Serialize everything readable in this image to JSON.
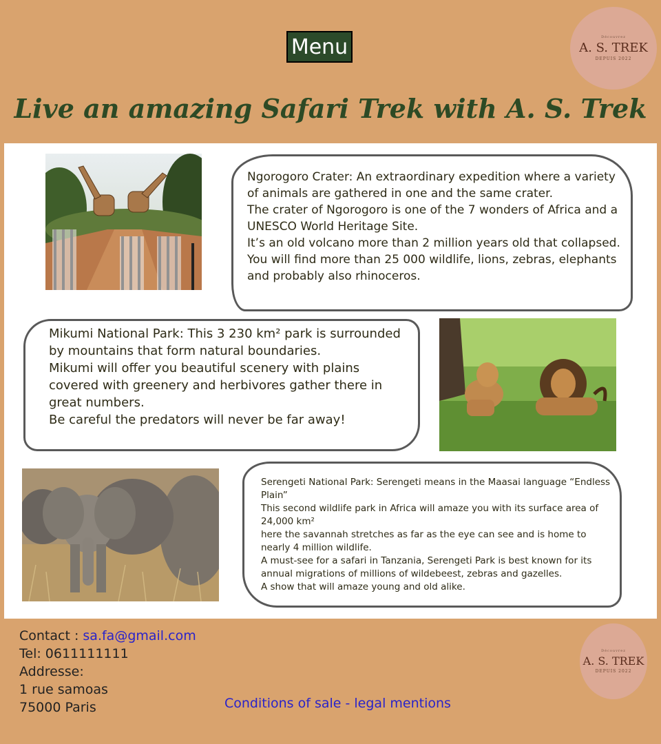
{
  "header": {
    "menu_label": "Menu",
    "logo": {
      "small": "Découvrez",
      "name": "A. S. TREK",
      "sub": "DEPUIS 2022"
    }
  },
  "headline": "Live an amazing Safari Trek with A. S. Trek",
  "sections": [
    {
      "image": "giraffes-zebras-photo",
      "lines": [
        "Ngorogoro Crater: An extraordinary expedition where a variety of animals are gathered in one and the same crater.",
        "The crater of Ngorogoro is one of the 7 wonders of Africa and a UNESCO World Heritage Site.",
        "It’s an old volcano more than 2 million years old that collapsed.",
        "You will find more than 25 000 wildlife, lions, zebras, elephants and probably also rhinoceros."
      ]
    },
    {
      "image": "lions-photo",
      "lines": [
        "Mikumi National Park: This 3 230 km² park is surrounded by mountains that form natural boundaries.",
        "Mikumi will offer you beautiful scenery with plains covered with greenery and herbivores gather there in great numbers.",
        "Be careful the predators will never be far away!"
      ]
    },
    {
      "image": "elephants-photo",
      "lines": [
        "Serengeti National Park: Serengeti means in the Maasai language “Endless Plain”",
        "This second wildlife park in Africa will amaze you with its surface area of 24,000 km²",
        "here the savannah stretches as far as the eye can see and is home to nearly 4 million wildlife.",
        "A must-see for a safari in Tanzania, Serengeti Park is best known for its annual migrations of millions of wildebeest, zebras and gazelles.",
        "A show that will amaze young and old alike."
      ]
    }
  ],
  "footer": {
    "contact_label": "Contact : ",
    "email": "sa.fa@gmail.com",
    "tel": "Tel: 0611111111",
    "address_label": "Addresse:",
    "street": "1 rue samoas",
    "city": "75000 Paris",
    "legal_link": "Conditions of sale - legal mentions"
  },
  "colors": {
    "background": "#d9a36e",
    "menu": "#2c4a2a",
    "headline": "#2d4a25",
    "link": "#2a23c9"
  }
}
